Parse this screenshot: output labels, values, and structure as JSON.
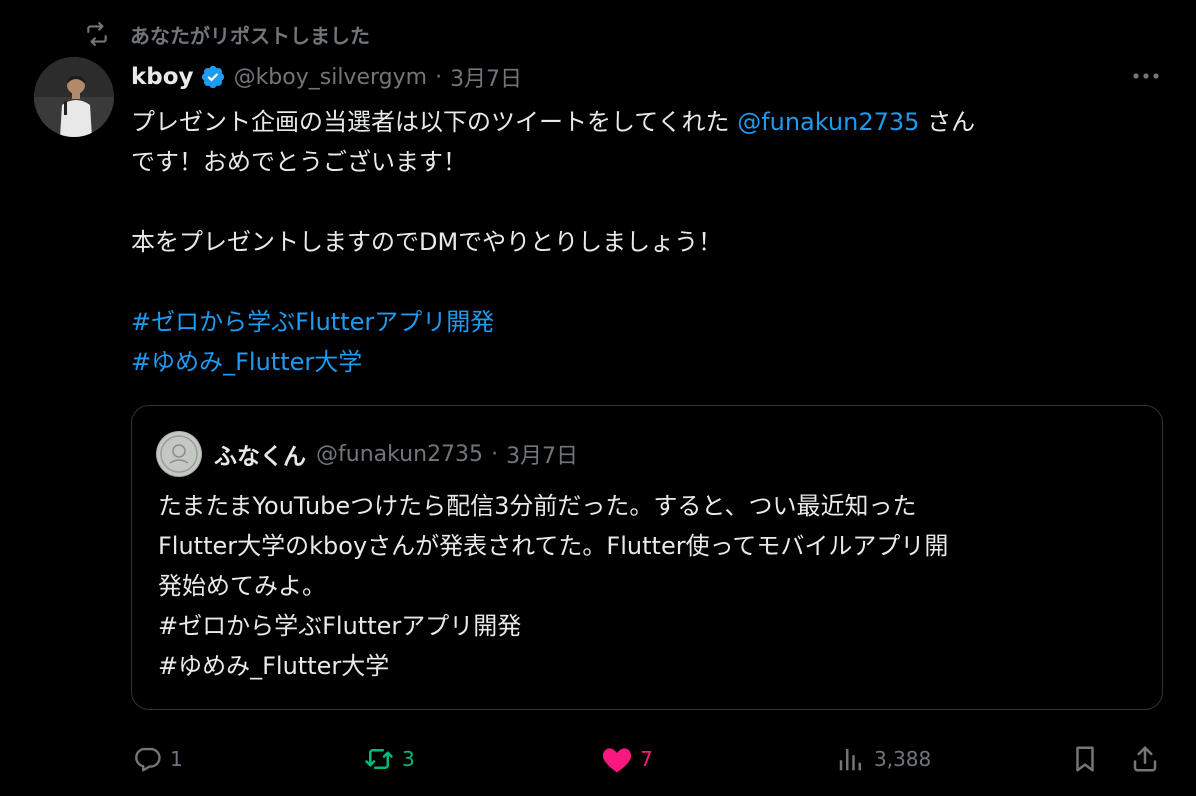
{
  "repost_context": {
    "text": "あなたがリポストしました",
    "icon": "repost-icon"
  },
  "author": {
    "display_name": "kboy",
    "verified": true,
    "handle": "@kboy_silvergym",
    "separator": "·",
    "date": "3月7日"
  },
  "tweet": {
    "line1_text": "プレゼント企画の当選者は以下のツイートをしてくれた ",
    "line1_mention": "@funakun2735",
    "line1_suffix": " さん",
    "line2": "です！おめでとうございます！",
    "line3": "本をプレゼントしますのでDMでやりとりしましょう！",
    "hashtag1": "#ゼロから学ぶFlutterアプリ開発",
    "hashtag2": "#ゆめみ_Flutter大学"
  },
  "quote": {
    "display_name": "ふなくん",
    "handle": "@funakun2735",
    "separator": "·",
    "date": "3月7日",
    "lines": [
      "たまたまYouTubeつけたら配信3分前だった。すると、つい最近知った",
      "Flutter大学のkboyさんが発表されてた。Flutter使ってモバイルアプリ開",
      "発始めてみよ。",
      "#ゼロから学ぶFlutterアプリ開発",
      "#ゆめみ_Flutter大学"
    ]
  },
  "actions": {
    "reply_count": "1",
    "retweet_count": "3",
    "like_count": "7",
    "views_count": "3,388"
  },
  "colors": {
    "background": "#000000",
    "text": "#e7e9ea",
    "muted": "#71767b",
    "link": "#1d9bf0",
    "retweet": "#00ba7c",
    "like": "#f91880",
    "border": "#2f3336"
  }
}
